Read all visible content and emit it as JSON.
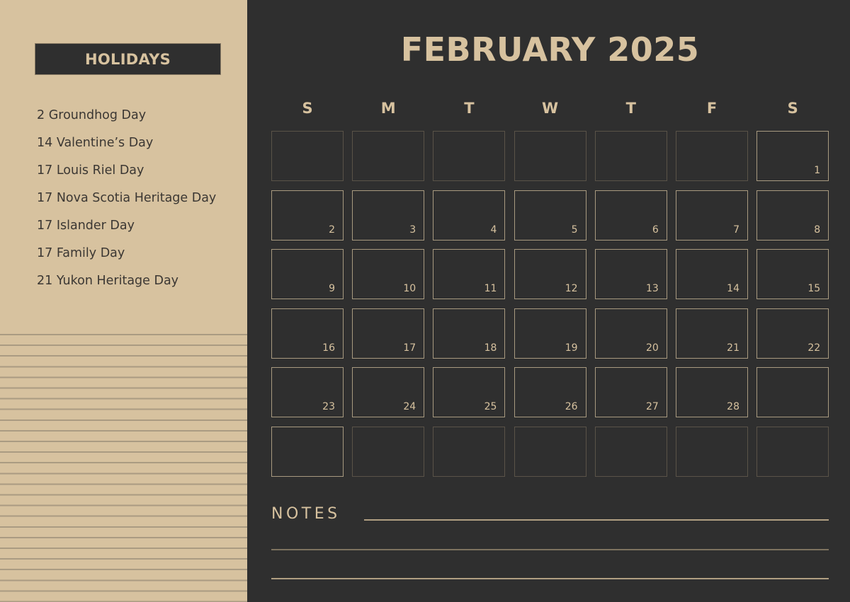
{
  "sidebar": {
    "header": "HOLIDAYS",
    "holidays": [
      "2 Groundhog Day",
      "14 Valentine’s Day",
      "17 Louis Riel Day",
      "17 Nova Scotia Heritage Day",
      "17 Islander Day",
      "17 Family Day",
      "21 Yukon Heritage Day"
    ]
  },
  "calendar": {
    "title": "FEBRUARY 2025",
    "weekdays": [
      "S",
      "M",
      "T",
      "W",
      "T",
      "F",
      "S"
    ],
    "weeks": [
      [
        {
          "d": "",
          "active": false
        },
        {
          "d": "",
          "active": false
        },
        {
          "d": "",
          "active": false
        },
        {
          "d": "",
          "active": false
        },
        {
          "d": "",
          "active": false
        },
        {
          "d": "",
          "active": false
        },
        {
          "d": "1",
          "active": true
        }
      ],
      [
        {
          "d": "2",
          "active": true
        },
        {
          "d": "3",
          "active": true
        },
        {
          "d": "4",
          "active": true
        },
        {
          "d": "5",
          "active": true
        },
        {
          "d": "6",
          "active": true
        },
        {
          "d": "7",
          "active": true
        },
        {
          "d": "8",
          "active": true
        }
      ],
      [
        {
          "d": "9",
          "active": true
        },
        {
          "d": "10",
          "active": true
        },
        {
          "d": "11",
          "active": true
        },
        {
          "d": "12",
          "active": true
        },
        {
          "d": "13",
          "active": true
        },
        {
          "d": "14",
          "active": true
        },
        {
          "d": "15",
          "active": true
        }
      ],
      [
        {
          "d": "16",
          "active": true
        },
        {
          "d": "17",
          "active": true
        },
        {
          "d": "18",
          "active": true
        },
        {
          "d": "19",
          "active": true
        },
        {
          "d": "20",
          "active": true
        },
        {
          "d": "21",
          "active": true
        },
        {
          "d": "22",
          "active": true
        }
      ],
      [
        {
          "d": "23",
          "active": true
        },
        {
          "d": "24",
          "active": true
        },
        {
          "d": "25",
          "active": true
        },
        {
          "d": "26",
          "active": true
        },
        {
          "d": "27",
          "active": true
        },
        {
          "d": "28",
          "active": true
        },
        {
          "d": "",
          "active": true
        }
      ],
      [
        {
          "d": "",
          "active": true
        },
        {
          "d": "",
          "active": false
        },
        {
          "d": "",
          "active": false
        },
        {
          "d": "",
          "active": false
        },
        {
          "d": "",
          "active": false
        },
        {
          "d": "",
          "active": false
        },
        {
          "d": "",
          "active": false
        }
      ]
    ]
  },
  "notes": {
    "label": "NOTES"
  },
  "colors": {
    "accent": "#d7c29f",
    "background": "#2f2f2f",
    "active_border": "#a89a80",
    "inactive_border": "#5a5348"
  }
}
